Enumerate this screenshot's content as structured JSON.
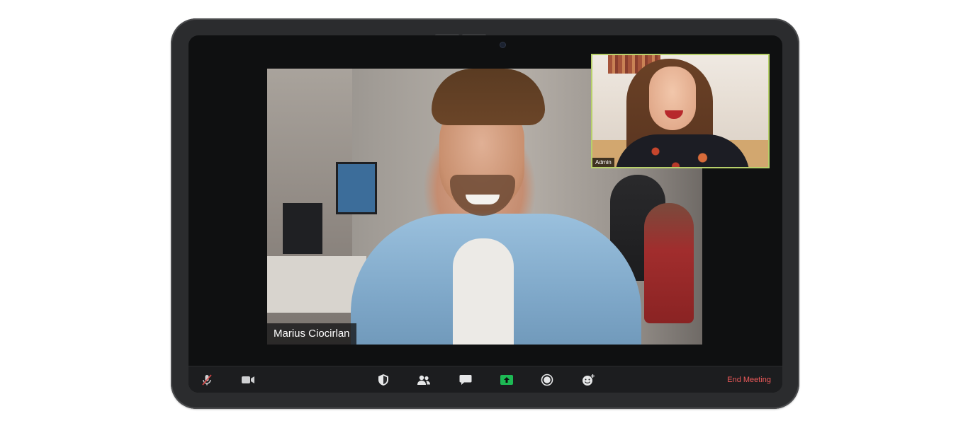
{
  "meeting": {
    "main_speaker_name": "Marius Ciocirlan",
    "self_view_label": "Admin"
  },
  "toolbar": {
    "buttons": [
      {
        "icon": "microphone-muted-icon",
        "state": "muted"
      },
      {
        "icon": "video-camera-icon"
      },
      {
        "icon": "security-shield-icon"
      },
      {
        "icon": "participants-icon"
      },
      {
        "icon": "chat-icon"
      },
      {
        "icon": "share-screen-icon",
        "accent": "#1db954"
      },
      {
        "icon": "record-icon"
      },
      {
        "icon": "reactions-icon"
      }
    ],
    "end_meeting_label": "End Meeting",
    "end_meeting_color": "#ee5a5a"
  },
  "colors": {
    "self_view_border": "#b7d06a"
  }
}
